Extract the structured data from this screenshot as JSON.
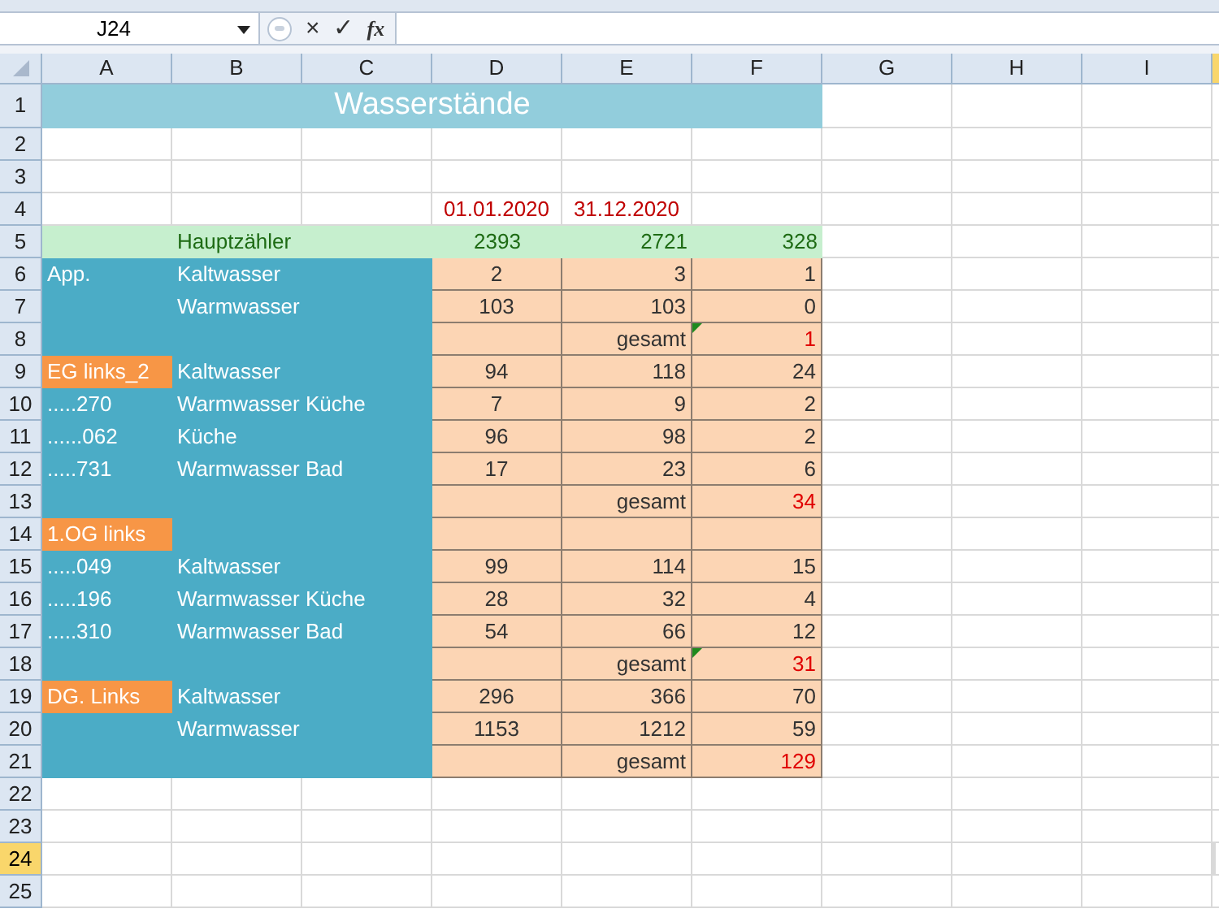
{
  "name_box": {
    "value": "J24"
  },
  "formula_bar": {
    "cancel": "×",
    "enter": "✓",
    "function": "fx"
  },
  "columns": [
    {
      "label": "A"
    },
    {
      "label": "B"
    },
    {
      "label": "C"
    },
    {
      "label": "D"
    },
    {
      "label": "E"
    },
    {
      "label": "F"
    },
    {
      "label": "G"
    },
    {
      "label": "H"
    },
    {
      "label": "I"
    }
  ],
  "rows": [
    {
      "number": "1",
      "kind": "title",
      "selected": false,
      "title": "Wasserstände"
    },
    {
      "number": "2",
      "kind": "blank",
      "selected": false
    },
    {
      "number": "3",
      "kind": "blank",
      "selected": false
    },
    {
      "number": "4",
      "kind": "dates",
      "selected": false,
      "d": "01.01.2020",
      "e": "31.12.2020"
    },
    {
      "number": "5",
      "kind": "main_meter",
      "selected": false,
      "b": "Hauptzähler",
      "d": "2393",
      "e": "2721",
      "f": "328"
    },
    {
      "number": "6",
      "kind": "meter",
      "selected": false,
      "highlighted": false,
      "a": "App.",
      "b": "Kaltwasser",
      "d": "2",
      "e": "3",
      "f": "1"
    },
    {
      "number": "7",
      "kind": "meter",
      "selected": false,
      "highlighted": false,
      "b": "Warmwasser",
      "d": "103",
      "e": "103",
      "f": "0"
    },
    {
      "number": "8",
      "kind": "subtotal",
      "selected": false,
      "highlighted": false,
      "flagged": true,
      "e": "gesamt",
      "f": "1"
    },
    {
      "number": "9",
      "kind": "meter",
      "selected": false,
      "highlighted": true,
      "a": "EG links_2",
      "b": "Kaltwasser",
      "d": "94",
      "e": "118",
      "f": "24"
    },
    {
      "number": "10",
      "kind": "meter",
      "selected": false,
      "highlighted": false,
      "a": ".....270",
      "b": "Warmwasser Küche",
      "d": "7",
      "e": "9",
      "f": "2"
    },
    {
      "number": "11",
      "kind": "meter",
      "selected": false,
      "highlighted": false,
      "a": "......062",
      "b": "Küche",
      "d": "96",
      "e": "98",
      "f": "2"
    },
    {
      "number": "12",
      "kind": "meter",
      "selected": false,
      "highlighted": false,
      "a": ".....731",
      "b": "Warmwasser Bad",
      "d": "17",
      "e": "23",
      "f": "6"
    },
    {
      "number": "13",
      "kind": "subtotal",
      "selected": false,
      "highlighted": false,
      "flagged": false,
      "e": "gesamt",
      "f": "34"
    },
    {
      "number": "14",
      "kind": "meter",
      "selected": false,
      "highlighted": true,
      "a": "1.OG links"
    },
    {
      "number": "15",
      "kind": "meter",
      "selected": false,
      "highlighted": false,
      "a": ".....049",
      "b": "Kaltwasser",
      "d": "99",
      "e": "114",
      "f": "15"
    },
    {
      "number": "16",
      "kind": "meter",
      "selected": false,
      "highlighted": false,
      "a": ".....196",
      "b": "Warmwasser Küche",
      "d": "28",
      "e": "32",
      "f": "4"
    },
    {
      "number": "17",
      "kind": "meter",
      "selected": false,
      "highlighted": false,
      "a": ".....310",
      "b": "Warmwasser Bad",
      "d": "54",
      "e": "66",
      "f": "12"
    },
    {
      "number": "18",
      "kind": "subtotal",
      "selected": false,
      "highlighted": false,
      "flagged": true,
      "e": "gesamt",
      "f": "31"
    },
    {
      "number": "19",
      "kind": "meter",
      "selected": false,
      "highlighted": true,
      "a": "DG. Links",
      "b": "Kaltwasser",
      "d": "296",
      "e": "366",
      "f": "70"
    },
    {
      "number": "20",
      "kind": "meter",
      "selected": false,
      "highlighted": false,
      "b": "Warmwasser",
      "d": "1153",
      "e": "1212",
      "f": "59"
    },
    {
      "number": "21",
      "kind": "subtotal",
      "selected": false,
      "highlighted": false,
      "flagged": false,
      "e": "gesamt",
      "f": "129"
    },
    {
      "number": "22",
      "kind": "blank",
      "selected": false
    },
    {
      "number": "23",
      "kind": "blank",
      "selected": false
    },
    {
      "number": "24",
      "kind": "blank",
      "selected": true
    },
    {
      "number": "25",
      "kind": "blank",
      "selected": false
    }
  ]
}
